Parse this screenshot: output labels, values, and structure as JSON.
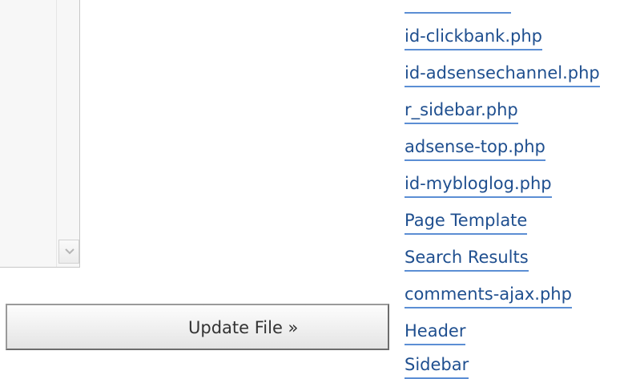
{
  "editor": {
    "scroll_arrow_icon": "chevron-down-icon"
  },
  "actions": {
    "update_label": "Update File »"
  },
  "file_list": {
    "items": [
      "id-clickbank.php",
      "id-adsensechannel.php",
      "r_sidebar.php",
      "adsense-top.php",
      "id-mybloglog.php",
      "Page Template",
      "Search Results",
      "comments-ajax.php",
      "Header",
      "Sidebar"
    ]
  },
  "colors": {
    "link": "#1f4f8f",
    "link_underline": "#5b8ed4",
    "button_border": "#9a9a9a"
  }
}
